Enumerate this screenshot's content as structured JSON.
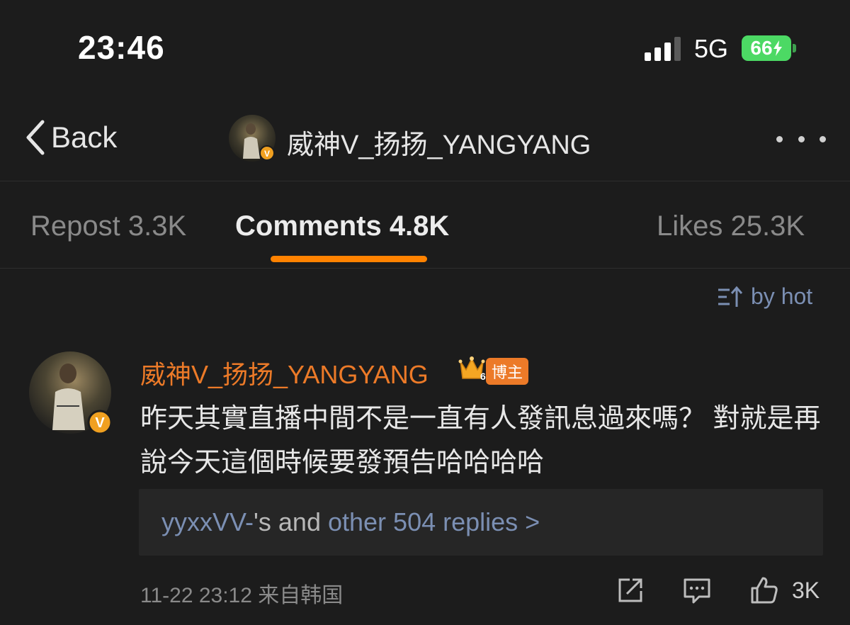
{
  "status_bar": {
    "time": "23:46",
    "network": "5G",
    "battery": "66"
  },
  "nav": {
    "back_label": "Back",
    "title": "威神V_扬扬_YANGYANG"
  },
  "tabs": [
    {
      "label": "Repost 3.3K",
      "active": false
    },
    {
      "label": "Comments 4.8K",
      "active": true
    },
    {
      "label": "Likes 25.3K",
      "active": false
    }
  ],
  "sort": {
    "label": "by hot"
  },
  "comment": {
    "author": "威神V_扬扬_YANGYANG",
    "badge": "博主",
    "badge_level": "6",
    "text": "昨天其實直播中間不是一直有人發訊息過來嗎？ 對就是再說今天這個時候要發預告哈哈哈哈",
    "reply_user": "yyxxVV-",
    "reply_mid": "'s and ",
    "reply_more": "other 504 replies >",
    "date_meta": "11-22 23:12 来自韩国",
    "likes": "3K"
  },
  "colors": {
    "accent": "#ff8200",
    "author": "#ec7a28",
    "link": "#7b8fb3",
    "battery": "#4cd964",
    "background": "#1c1c1c"
  },
  "icons": [
    "signal-icon",
    "battery-icon",
    "back-chevron-icon",
    "more-icon",
    "sort-icon",
    "verified-icon",
    "crown-badge-icon",
    "share-icon",
    "comment-icon",
    "like-icon"
  ]
}
